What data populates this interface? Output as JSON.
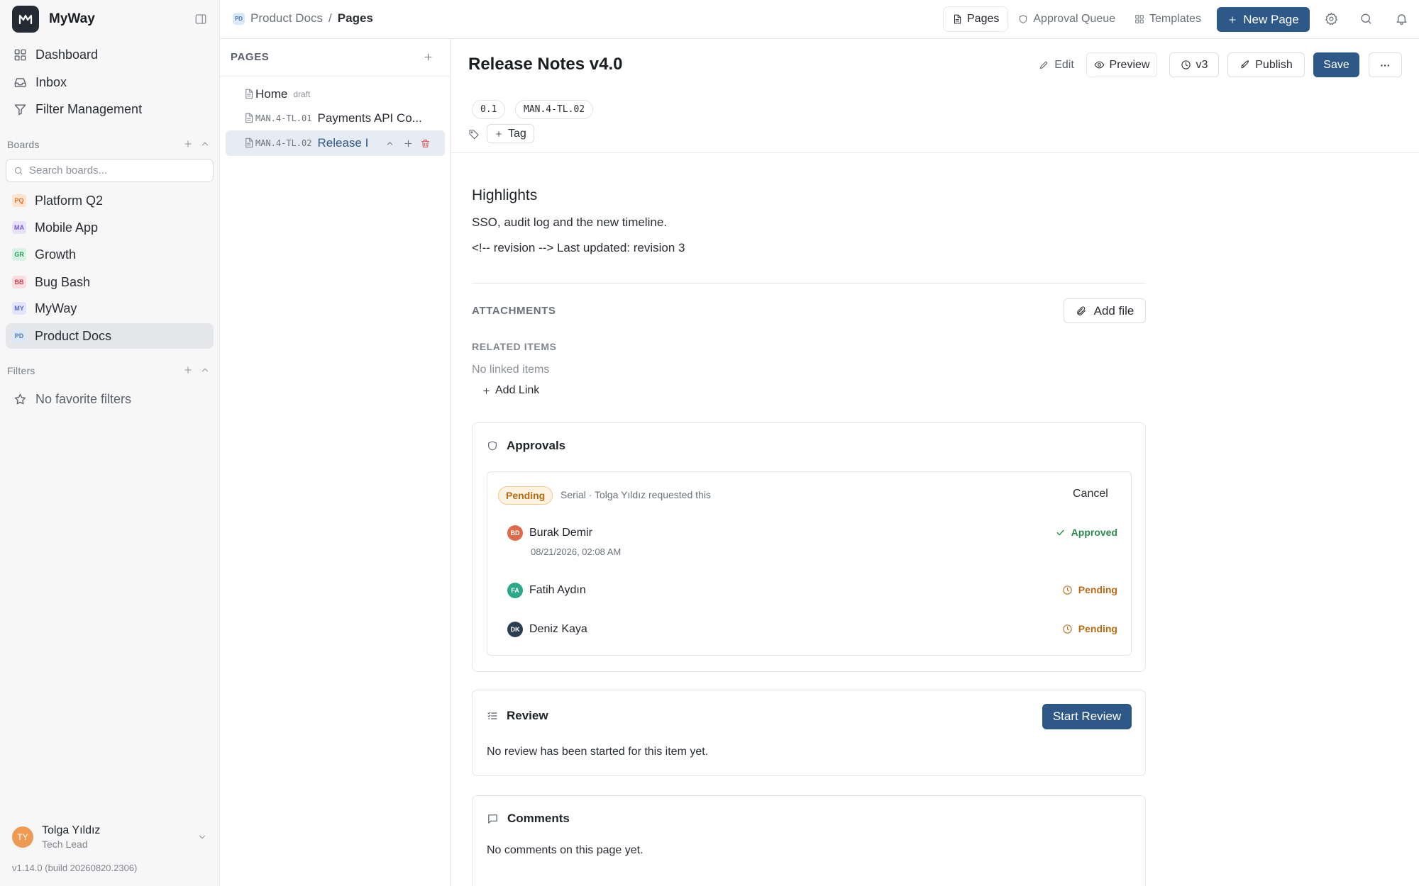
{
  "app": {
    "name": "MyWay"
  },
  "sidebar": {
    "nav": [
      {
        "label": "Dashboard",
        "icon": "dashboard-icon"
      },
      {
        "label": "Inbox",
        "icon": "inbox-icon"
      },
      {
        "label": "Filter Management",
        "icon": "filter-icon"
      }
    ],
    "boards_label": "Boards",
    "search_placeholder": "Search boards...",
    "boards": [
      {
        "badge": "PQ",
        "label": "Platform Q2",
        "bg": "#fde3d0",
        "fg": "#d8722d"
      },
      {
        "badge": "MA",
        "label": "Mobile App",
        "bg": "#e8e1fb",
        "fg": "#7b5bd6"
      },
      {
        "badge": "GR",
        "label": "Growth",
        "bg": "#d8f3e4",
        "fg": "#2f9a5c"
      },
      {
        "badge": "BB",
        "label": "Bug Bash",
        "bg": "#fbdde1",
        "fg": "#d2414f"
      },
      {
        "badge": "MY",
        "label": "MyWay",
        "bg": "#e2e5fb",
        "fg": "#5866cf"
      },
      {
        "badge": "PD",
        "label": "Product Docs",
        "bg": "#dbe8f8",
        "fg": "#4a78b0",
        "active": true
      }
    ],
    "filters_label": "Filters",
    "no_filters": "No favorite filters",
    "user": {
      "initials": "TY",
      "name": "Tolga Yıldız",
      "role": "Tech Lead"
    },
    "version": "v1.14.0 (build 20260820.2306)"
  },
  "topbar": {
    "breadcrumb": {
      "badge": "PD",
      "project": "Product Docs",
      "sep": "/",
      "current": "Pages"
    },
    "tabs": [
      {
        "label": "Pages",
        "icon": "page-icon",
        "active": true
      },
      {
        "label": "Approval Queue",
        "icon": "shield-icon"
      },
      {
        "label": "Templates",
        "icon": "grid-icon"
      }
    ],
    "new_page": "New Page"
  },
  "pages": {
    "header": "PAGES",
    "items": [
      {
        "code": "",
        "title": "Home",
        "tag": "draft"
      },
      {
        "code": "MAN.4-TL.01",
        "title": "Payments API Co..."
      },
      {
        "code": "MAN.4-TL.02",
        "title": "Release I",
        "selected": true
      }
    ]
  },
  "doc": {
    "title": "Release Notes v4.0",
    "toolbar": {
      "edit": "Edit",
      "preview": "Preview",
      "version": "v3",
      "publish": "Publish",
      "save": "Save",
      "more": "···"
    },
    "chips": [
      "0.1",
      "MAN.4-TL.02"
    ],
    "tag_button": "Tag",
    "heading": "Highlights",
    "body_line1": "SSO, audit log and the new timeline.",
    "body_line2": "<!-- revision --> Last updated: revision 3",
    "attachments_label": "ATTACHMENTS",
    "add_file": "Add file",
    "related_label": "RELATED ITEMS",
    "no_linked": "No linked items",
    "add_link": "Add Link"
  },
  "approvals": {
    "title": "Approvals",
    "status": "Pending",
    "meta": "Serial · Tolga Yıldız requested this",
    "cancel": "Cancel",
    "approvers": [
      {
        "initials": "BD",
        "name": "Burak Demir",
        "status": "Approved",
        "date": "08/21/2026, 02:08 AM",
        "avatar": "#e0694a",
        "color": "#2f8a4e"
      },
      {
        "initials": "FA",
        "name": "Fatih Aydın",
        "status": "Pending",
        "date": "",
        "avatar": "#2aa889",
        "color": "#b86a12"
      },
      {
        "initials": "DK",
        "name": "Deniz Kaya",
        "status": "Pending",
        "date": "",
        "avatar": "#2c3e50",
        "color": "#b86a12"
      }
    ]
  },
  "review": {
    "title": "Review",
    "button": "Start Review",
    "empty": "No review has been started for this item yet."
  },
  "comments": {
    "title": "Comments",
    "empty": "No comments on this page yet."
  }
}
